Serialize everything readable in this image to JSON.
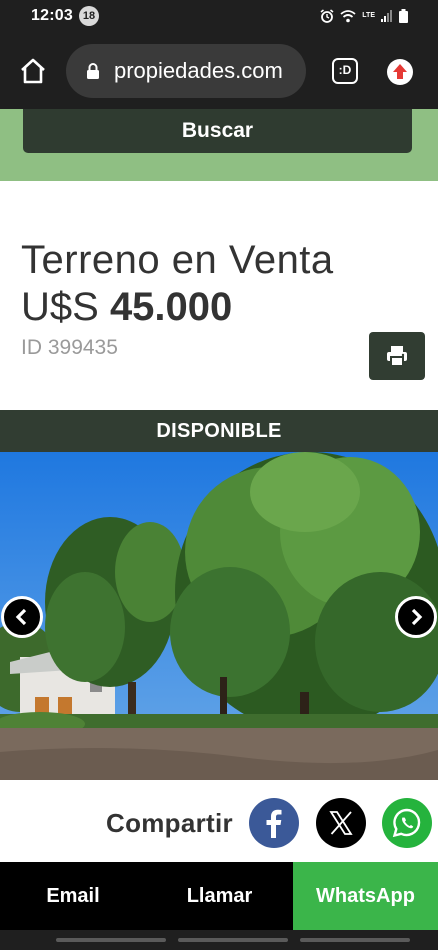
{
  "status_bar": {
    "time": "12:03",
    "notification_count": "18",
    "lte_label": "LTE"
  },
  "browser": {
    "url_text": "propiedades.com",
    "tab_label": ":D"
  },
  "search": {
    "button_label": "Buscar"
  },
  "listing": {
    "title": "Terreno en Venta",
    "price_currency": "U$S",
    "price_amount": "45.000",
    "id_label": "ID 399435",
    "availability": "DISPONIBLE"
  },
  "share": {
    "label": "Compartir",
    "networks": [
      {
        "name": "facebook",
        "icon": "facebook-icon",
        "color": "#3b5998"
      },
      {
        "name": "x",
        "icon": "x-icon",
        "color": "#000000"
      },
      {
        "name": "whatsapp",
        "icon": "whatsapp-icon",
        "color": "#25b33d"
      }
    ]
  },
  "actions": {
    "email_label": "Email",
    "call_label": "Llamar",
    "whatsapp_label": "WhatsApp"
  },
  "colors": {
    "accent_green": "#8fbf83",
    "dark_green": "#313d32",
    "whatsapp_green": "#3bb54a"
  }
}
